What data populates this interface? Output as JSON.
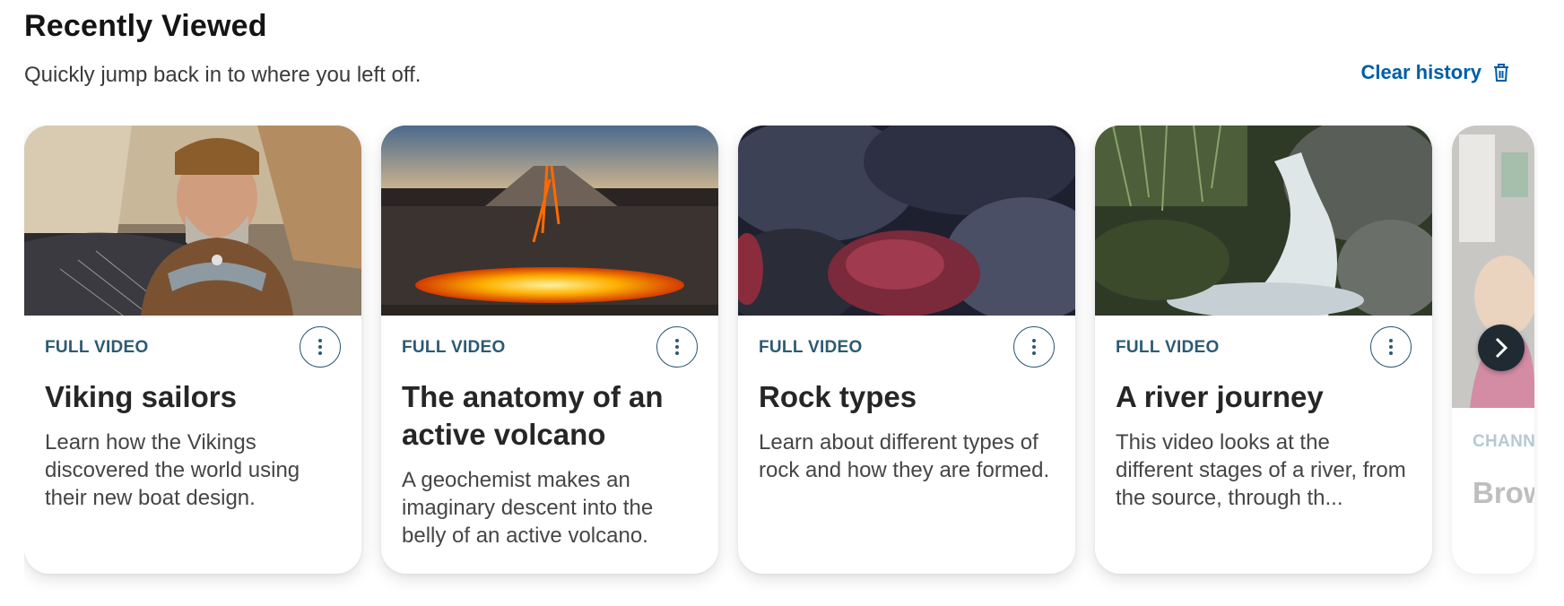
{
  "section": {
    "title": "Recently Viewed",
    "subtitle": "Quickly jump back in to where you left off.",
    "clear_history_label": "Clear history"
  },
  "cards": [
    {
      "type": "FULL VIDEO",
      "title": "Viking sailors",
      "description": "Learn how the Vikings discovered the world using their new boat design."
    },
    {
      "type": "FULL VIDEO",
      "title": "The anatomy of an active volcano",
      "description": "A geochemist makes an imaginary descent into the belly of an active volcano."
    },
    {
      "type": "FULL VIDEO",
      "title": "Rock types",
      "description": "Learn about different types of rock and how they are formed."
    },
    {
      "type": "FULL VIDEO",
      "title": "A river journey",
      "description": "This video looks at the different stages of a river, from the source, through th..."
    },
    {
      "type": "CHANN",
      "title": "Brow grou"
    }
  ],
  "icons": {
    "clear_history": "trash-icon",
    "more": "more-vertical-icon",
    "next": "chevron-right-icon"
  },
  "colors": {
    "accent_link": "#005ea5",
    "card_type": "#2c5a73",
    "next_button": "#1f2a33"
  }
}
